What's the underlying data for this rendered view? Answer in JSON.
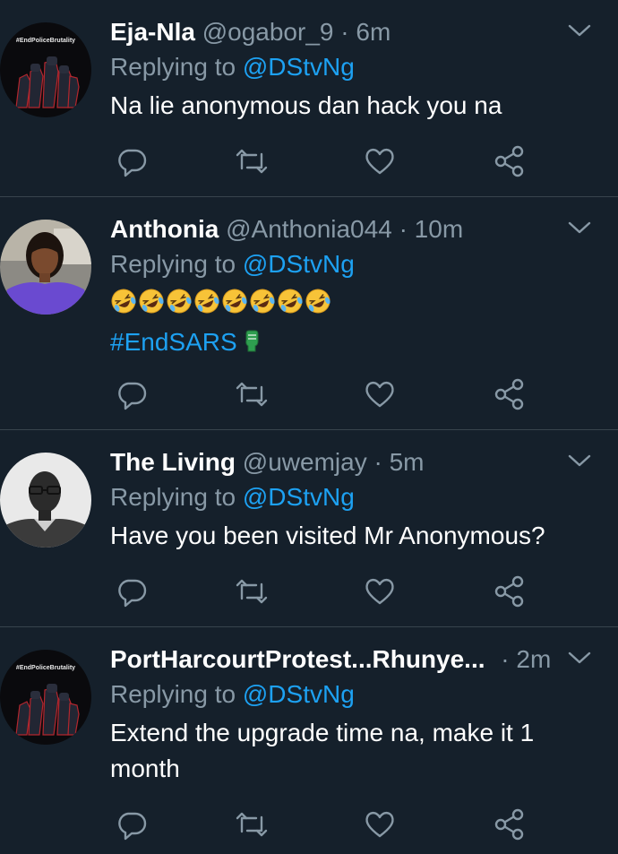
{
  "tweets": [
    {
      "name": "Eja-Nla",
      "handle": "@ogabor_9",
      "time": "6m",
      "replying_prefix": "Replying to",
      "replying_to": "@DStvNg",
      "text": "Na lie anonymous dan hack you na",
      "avatar": "endpolicebrutality-avatar",
      "avatar_text": "#EndPoliceBrutality"
    },
    {
      "name": "Anthonia",
      "handle": "@Anthonia044",
      "time": "10m",
      "replying_prefix": "Replying to",
      "replying_to": "@DStvNg",
      "emoji": "rolling-on-floor-laughing-emoji",
      "emoji_count": 8,
      "hashtag": "#EndSARS",
      "hashtag_icon": "fist-icon",
      "avatar": "woman-photo-avatar"
    },
    {
      "name": "The Living",
      "handle": "@uwemjay",
      "time": "5m",
      "replying_prefix": "Replying to",
      "replying_to": "@DStvNg",
      "text": "Have you been visited Mr Anonymous?",
      "avatar": "man-bw-photo-avatar"
    },
    {
      "name": "PortHarcourtProtest...Rhunye...",
      "handle": "",
      "time": "2m",
      "replying_prefix": "Replying to",
      "replying_to": "@DStvNg",
      "text_line1": "Extend the upgrade time na, make it 1",
      "text_line2": "month",
      "avatar": "endpolicebrutality-avatar",
      "avatar_text": "#EndPoliceBrutality"
    }
  ],
  "separator": "·",
  "icons": [
    "reply-icon",
    "retweet-icon",
    "like-icon",
    "share-icon",
    "chevron-down-icon"
  ],
  "colors": {
    "background": "#15202b",
    "muted": "#8899a6",
    "accent": "#1da1f2",
    "divider": "#38444d"
  }
}
